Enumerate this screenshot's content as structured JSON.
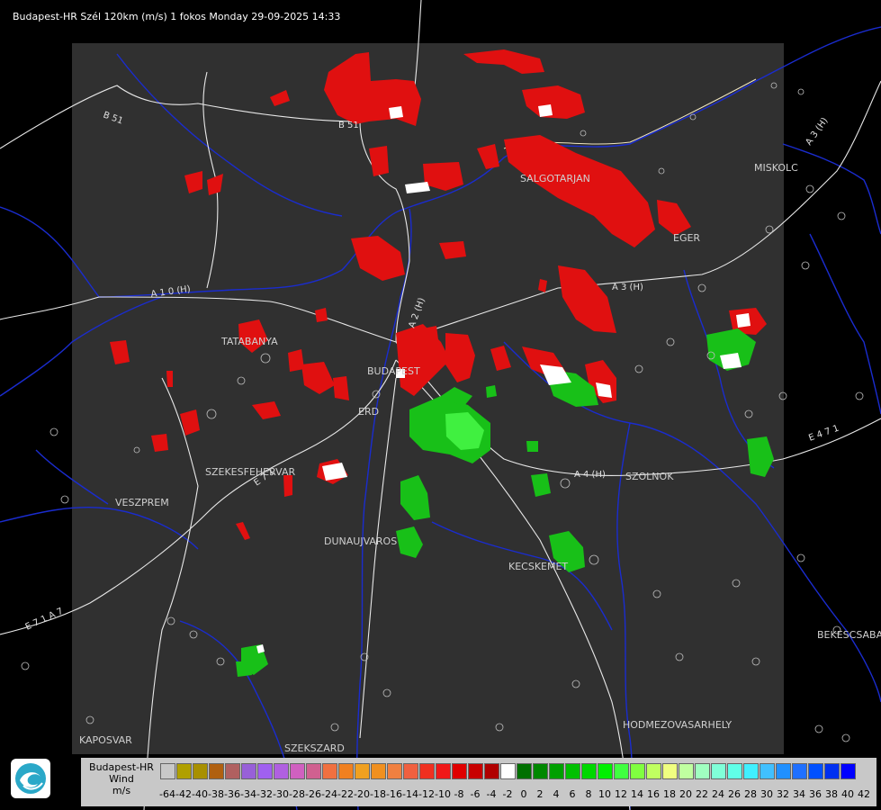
{
  "title": "Budapest-HR Szél 120km (m/s) 1 fokos Monday 29-09-2025 14:33",
  "legend": {
    "title_lines": [
      "Budapest-HR",
      "Wind",
      "m/s"
    ],
    "ticks": [
      "-64",
      "-42",
      "-40",
      "-38",
      "-36",
      "-34",
      "-32",
      "-30",
      "-28",
      "-26",
      "-24",
      "-22",
      "-20",
      "-18",
      "-16",
      "-14",
      "-12",
      "-10",
      "-8",
      "-6",
      "-4",
      "-2",
      "0",
      "2",
      "4",
      "6",
      "8",
      "10",
      "12",
      "14",
      "16",
      "18",
      "20",
      "22",
      "24",
      "26",
      "28",
      "30",
      "32",
      "34",
      "36",
      "38",
      "40",
      "42"
    ],
    "colors": [
      "#c8c8c8",
      "#b0a000",
      "#a89000",
      "#b06010",
      "#b06060",
      "#9860d8",
      "#a060f0",
      "#b060e0",
      "#d060c0",
      "#d06090",
      "#f07040",
      "#f08020",
      "#f0a020",
      "#f09020",
      "#f08040",
      "#f06040",
      "#f03020",
      "#f01818",
      "#e00000",
      "#c80000",
      "#b00000",
      "#ffffff",
      "#007000",
      "#008800",
      "#00a000",
      "#00c000",
      "#00d800",
      "#00f000",
      "#40ff40",
      "#80ff40",
      "#c0ff60",
      "#f0ff80",
      "#c0ffa0",
      "#a0ffc0",
      "#80ffd8",
      "#60ffe8",
      "#40f0ff",
      "#40c0ff",
      "#2090ff",
      "#2070ff",
      "#0050ff",
      "#0030f0",
      "#0000ff"
    ],
    "icons": {
      "logo": "omsz-logo-icon"
    }
  },
  "map": {
    "cities": [
      "SALGOTARJAN",
      "MISKOLC",
      "EGER",
      "TATABANYA",
      "BUDAPEST",
      "ERD",
      "SZEKESFEHERVAR",
      "VESZPREM",
      "DUNAUJVAROS",
      "KECSKEMET",
      "SZOLNOK",
      "BEKESCSABA",
      "HODMEZOVASARHELY",
      "KAPOSVAR",
      "SZEKSZARD"
    ],
    "roads": [
      "B 51",
      "B 51",
      "A 3 (H)",
      "A 3 (H)",
      "A 1 0 (H)",
      "A 2 (H)",
      "A 4 (H)",
      "E 4 7 1",
      "E 7 1",
      "E 7 1 A 7"
    ],
    "colors": {
      "panel": "#303030",
      "outside": "#000000",
      "rivers": "#1a2ccf",
      "roads": "#ffffff",
      "approach": "#ff1010",
      "recede": "#10c010"
    }
  }
}
